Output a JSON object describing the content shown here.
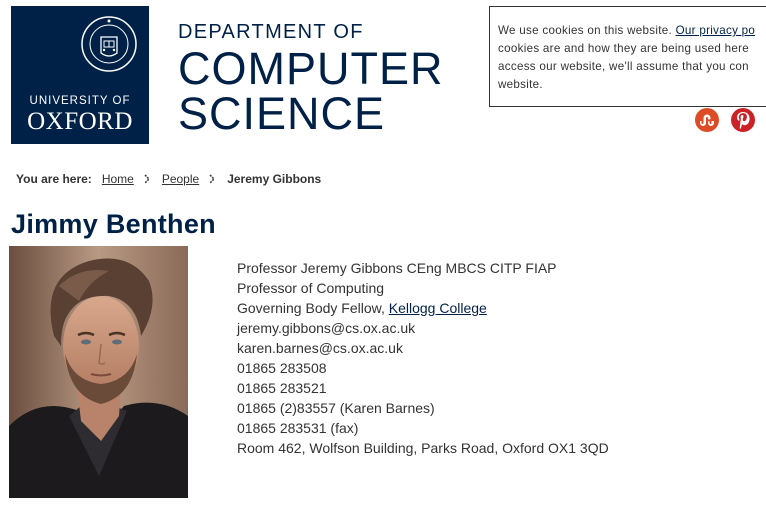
{
  "logo": {
    "university_label": "UNIVERSITY OF",
    "name": "OXFORD",
    "colors": {
      "navy": "#002147"
    }
  },
  "department": {
    "line1": "DEPARTMENT OF",
    "line2": "COMPUTER",
    "line3": "SCIENCE"
  },
  "cookie_notice": {
    "line1_text": "We use cookies on this website. ",
    "line1_link": "Our privacy po",
    "line2": "cookies are and how they are being used here",
    "line3": "access our website, we'll assume that you con",
    "line4": "website."
  },
  "social": {
    "items": [
      {
        "icon": "stumbleupon-icon",
        "color": "#dd4b27"
      },
      {
        "icon": "pinterest-icon",
        "color": "#cc2127"
      }
    ]
  },
  "breadcrumb": {
    "prefix": "You are here:",
    "items": [
      "Home",
      "People"
    ],
    "current": "Jeremy Gibbons"
  },
  "profile": {
    "heading": "Jimmy Benthen",
    "title": "Professor Jeremy Gibbons CEng MBCS CITP FIAP",
    "position": "Professor of Computing",
    "fellowship_prefix": "Governing Body Fellow, ",
    "fellowship_college": "Kellogg College",
    "email": "jeremy.gibbons@cs.ox.ac.uk",
    "email_secondary": "karen.barnes@cs.ox.ac.uk",
    "phone1": "01865 283508",
    "phone2": "01865 283521",
    "phone3": "01865 (2)83557 (Karen Barnes)",
    "fax": "01865 283531 (fax)",
    "address": "Room 462, Wolfson Building, Parks Road, Oxford OX1 3QD"
  }
}
